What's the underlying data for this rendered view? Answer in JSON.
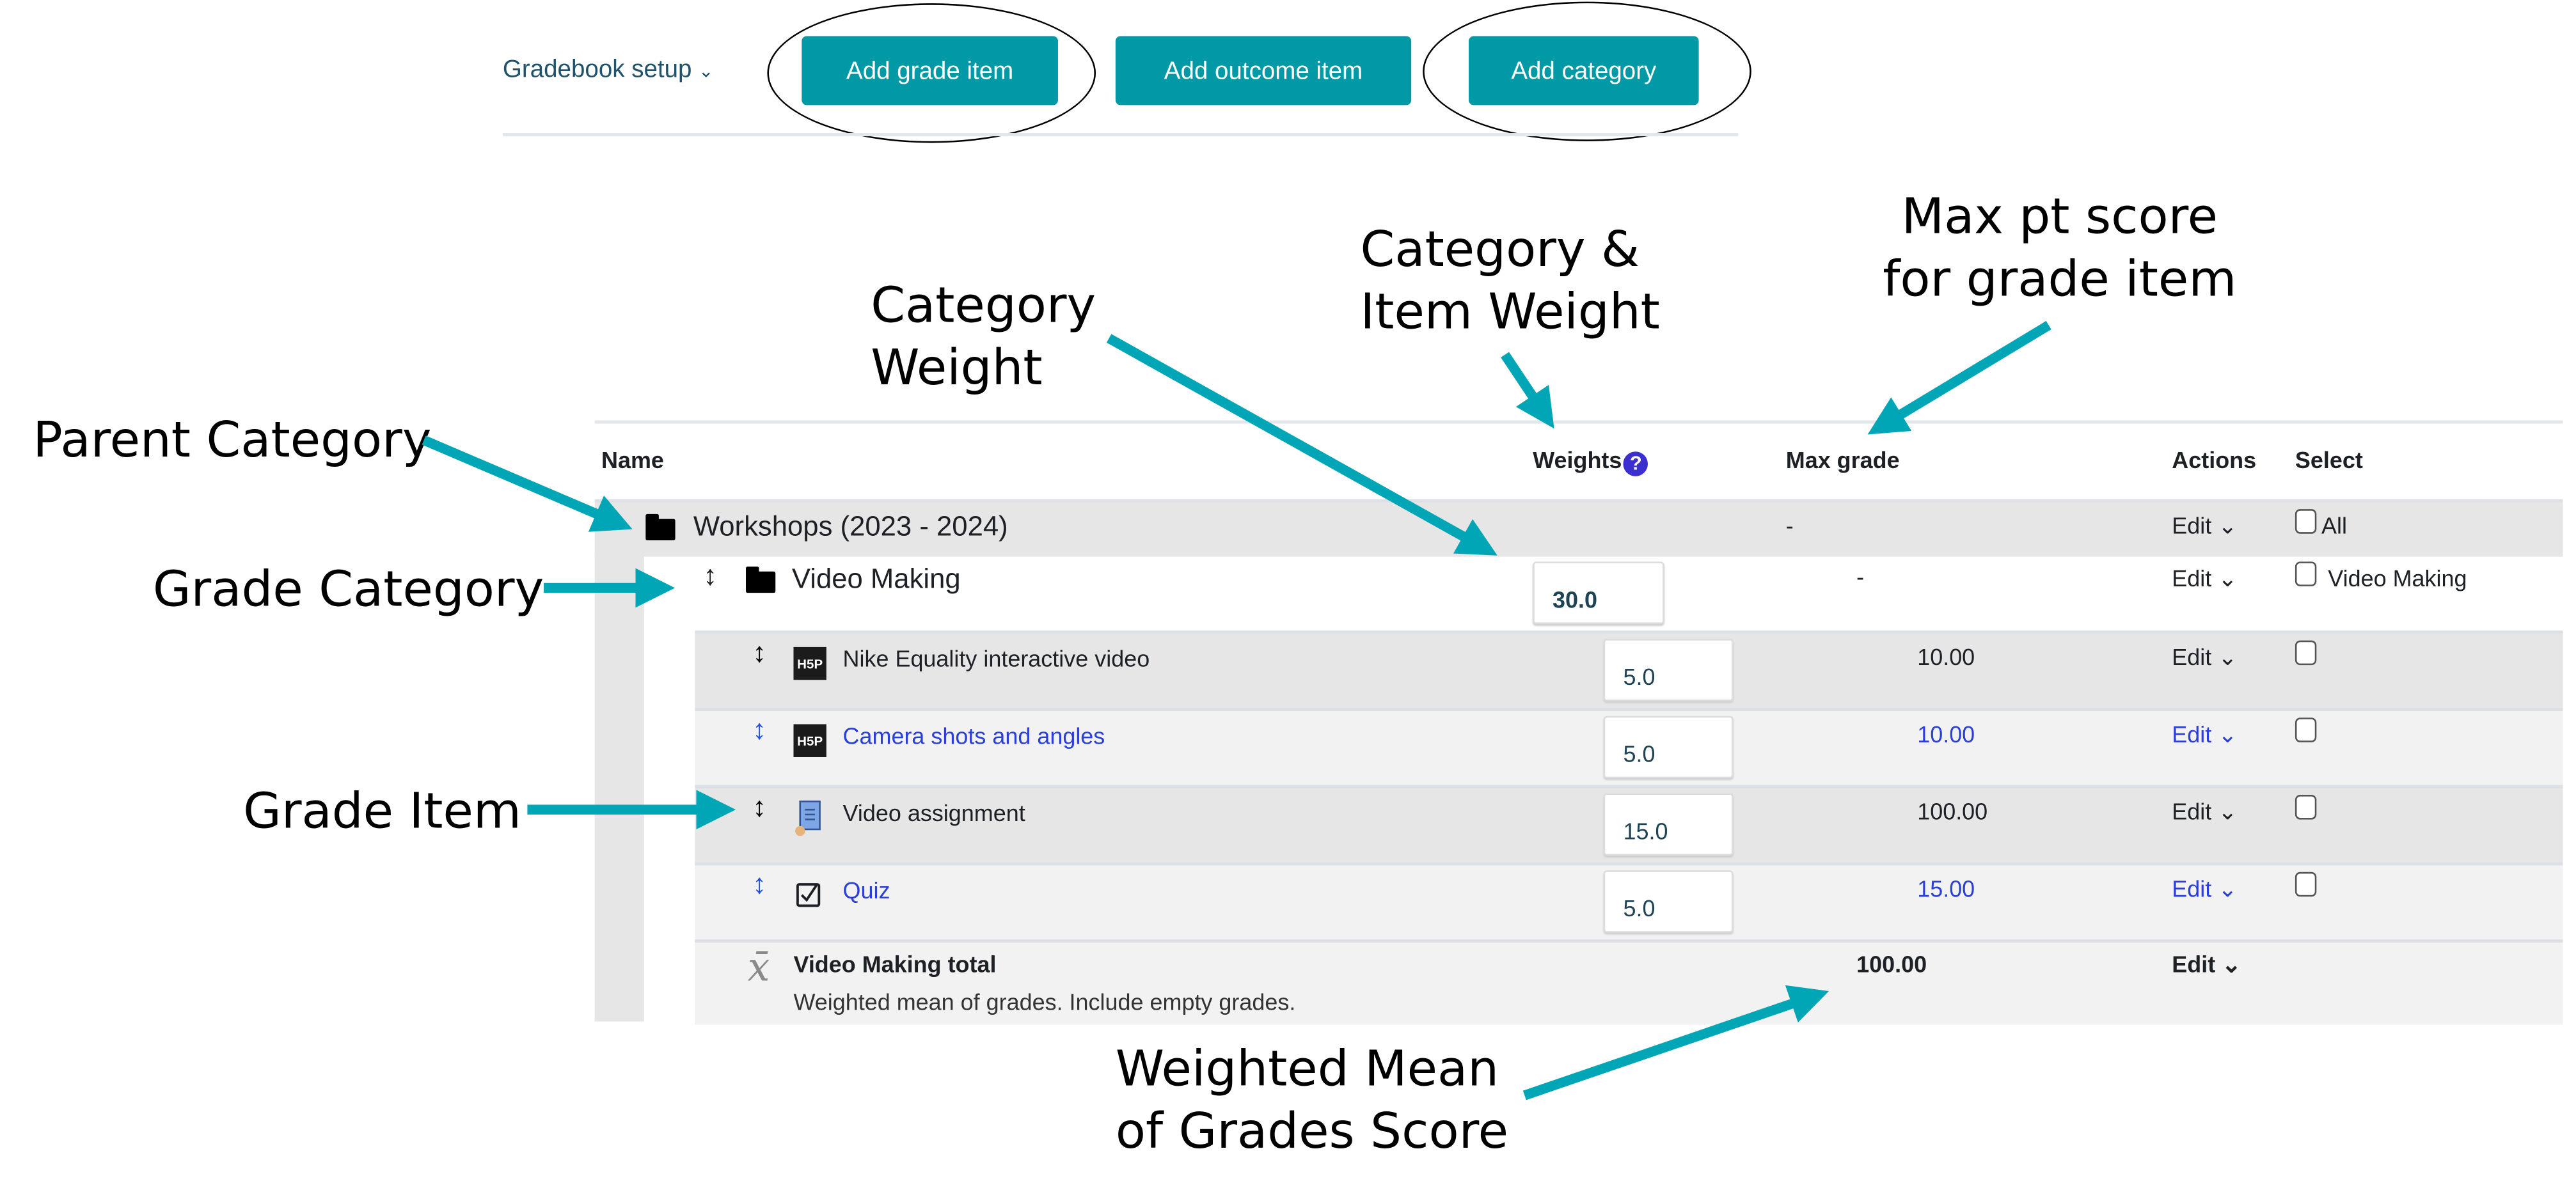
{
  "toolbar": {
    "gradebook_setup_label": "Gradebook setup",
    "chevron": "⌄",
    "add_grade_item_label": "Add grade item",
    "add_outcome_item_label": "Add outcome item",
    "add_category_label": "Add category"
  },
  "table": {
    "headers": {
      "name": "Name",
      "weights": "Weights",
      "help_icon": "?",
      "max_grade": "Max grade",
      "actions": "Actions",
      "select": "Select"
    },
    "parent_category": {
      "name": "Workshops (2023 - 2024)",
      "max_grade": "-",
      "action": "Edit",
      "select_label": "All"
    },
    "grade_category": {
      "name": "Video Making",
      "weight": "30.0",
      "max_grade": "-",
      "action": "Edit",
      "select_label": "Video Making"
    },
    "items": [
      {
        "name": "Nike Equality interactive video",
        "icon": "h5p-icon",
        "icon_text": "H5P",
        "weight": "5.0",
        "max_grade": "10.00",
        "action": "Edit",
        "is_link": false
      },
      {
        "name": "Camera shots and angles",
        "icon": "h5p-icon",
        "icon_text": "H5P",
        "weight": "5.0",
        "max_grade": "10.00",
        "action": "Edit",
        "is_link": true
      },
      {
        "name": "Video assignment",
        "icon": "assignment-icon",
        "weight": "15.0",
        "max_grade": "100.00",
        "action": "Edit",
        "is_link": false
      },
      {
        "name": "Quiz",
        "icon": "quiz-icon",
        "weight": "5.0",
        "max_grade": "15.00",
        "action": "Edit",
        "is_link": true
      }
    ],
    "total": {
      "name": "Video Making total",
      "description": "Weighted mean of grades. Include empty grades.",
      "icon_glyph": "x̄",
      "max_grade": "100.00",
      "action": "Edit"
    }
  },
  "annotations": {
    "parent_category": "Parent Category",
    "grade_category": "Grade Category",
    "grade_item": "Grade Item",
    "category_weight_line1": "Category",
    "category_weight_line2": "Weight",
    "cat_item_weight_line1": "Category &",
    "cat_item_weight_line2": "Item Weight",
    "max_pt_line1": "Max pt score",
    "max_pt_line2": "for grade item",
    "weighted_mean_line1": "Weighted Mean",
    "weighted_mean_line2": "of Grades Score"
  },
  "colors": {
    "accent": "#0099a5",
    "arrow": "#00a6b5",
    "link": "#2a3fd6"
  }
}
